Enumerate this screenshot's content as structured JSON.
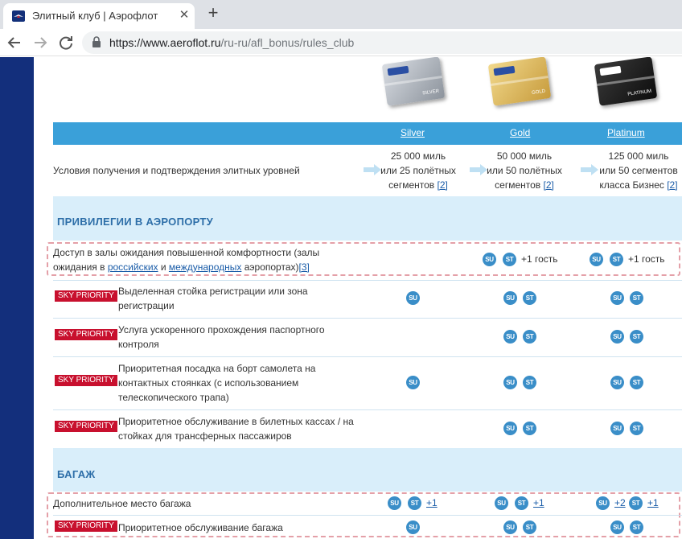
{
  "browser": {
    "tab_title": "Элитный клуб | Аэрофлот",
    "url_host": "https://www.aeroflot.ru",
    "url_path": "/ru-ru/afl_bonus/rules_club"
  },
  "cards": {
    "silver": "SILVER",
    "gold": "GOLD",
    "platinum": "PLATINUM"
  },
  "levels": [
    "Silver",
    "Gold",
    "Platinum"
  ],
  "conditions": {
    "label": "Условия получения и подтверждения элитных уровней",
    "silver": [
      "25 000 миль",
      "или 25 полётных",
      "сегментов"
    ],
    "gold": [
      "50 000 миль",
      "или 50 полётных",
      "сегментов"
    ],
    "platinum": [
      "125 000 миль",
      "или 50 сегментов",
      "класса Бизнес"
    ],
    "ref": "[2]"
  },
  "sections": {
    "airport": "ПРИВИЛЕГИИ В АЭРОПОРТУ",
    "baggage": "БАГАЖ"
  },
  "badge": "SKY PRIORITY",
  "icons": {
    "su": "SU",
    "st": "ST"
  },
  "rows": {
    "lounge": {
      "line1": "Доступ в залы ожидания повышенной комфортности (залы",
      "prefix": "ожидания в ",
      "link1": "российских",
      "mid": " и ",
      "link2": "международных",
      "suffix": " аэропортах)",
      "ref": "[3]",
      "guest": "+1 гость"
    },
    "checkin": [
      "Выделенная стойка регистрации или зона",
      "регистрации"
    ],
    "passport": [
      "Услуга ускоренного прохождения паспортного",
      "контроля"
    ],
    "boarding": [
      "Приоритетная посадка на борт самолета на",
      "контактных стоянках (с использованием",
      "телескопического трапа)"
    ],
    "ticket": [
      "Приоритетное обслуживание в билетных кассах / на",
      "стойках для трансферных пассажиров"
    ],
    "extra_bag": {
      "label": "Дополнительное место багажа",
      "plus1": "+1",
      "plus2": "+2"
    },
    "priority_bag": "Приоритетное обслуживание багажа"
  }
}
